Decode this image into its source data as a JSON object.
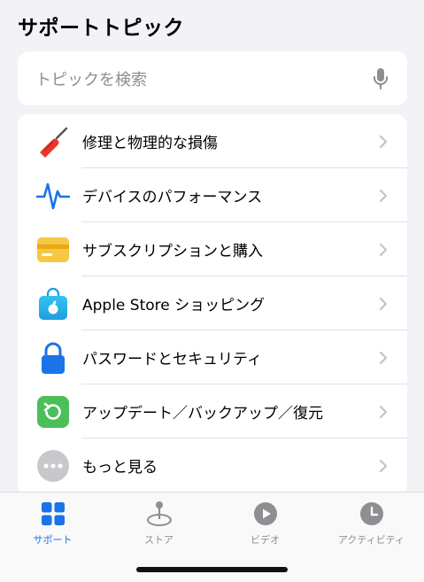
{
  "header": {
    "title": "サポートトピック"
  },
  "search": {
    "placeholder": "トピックを検索",
    "icon": "microphone-icon"
  },
  "topics": [
    {
      "label": "修理と物理的な損傷",
      "icon": "screwdriver-icon"
    },
    {
      "label": "デバイスのパフォーマンス",
      "icon": "heartbeat-icon"
    },
    {
      "label": "サブスクリプションと購入",
      "icon": "credit-card-icon"
    },
    {
      "label": "Apple Store ショッピング",
      "icon": "apple-store-bag-icon"
    },
    {
      "label": "パスワードとセキュリティ",
      "icon": "lock-icon"
    },
    {
      "label": "アップデート／バックアップ／復元",
      "icon": "restore-icon"
    },
    {
      "label": "もっと見る",
      "icon": "more-icon"
    }
  ],
  "tabs": [
    {
      "label": "サポート",
      "icon": "grid-icon",
      "active": true
    },
    {
      "label": "ストア",
      "icon": "joystick-icon",
      "active": false
    },
    {
      "label": "ビデオ",
      "icon": "play-icon",
      "active": false
    },
    {
      "label": "アクティビティ",
      "icon": "clock-icon",
      "active": false
    }
  ],
  "colors": {
    "accent": "#1a73e8",
    "inactive_tab": "#8e8e93",
    "background": "#f2f2f7"
  }
}
